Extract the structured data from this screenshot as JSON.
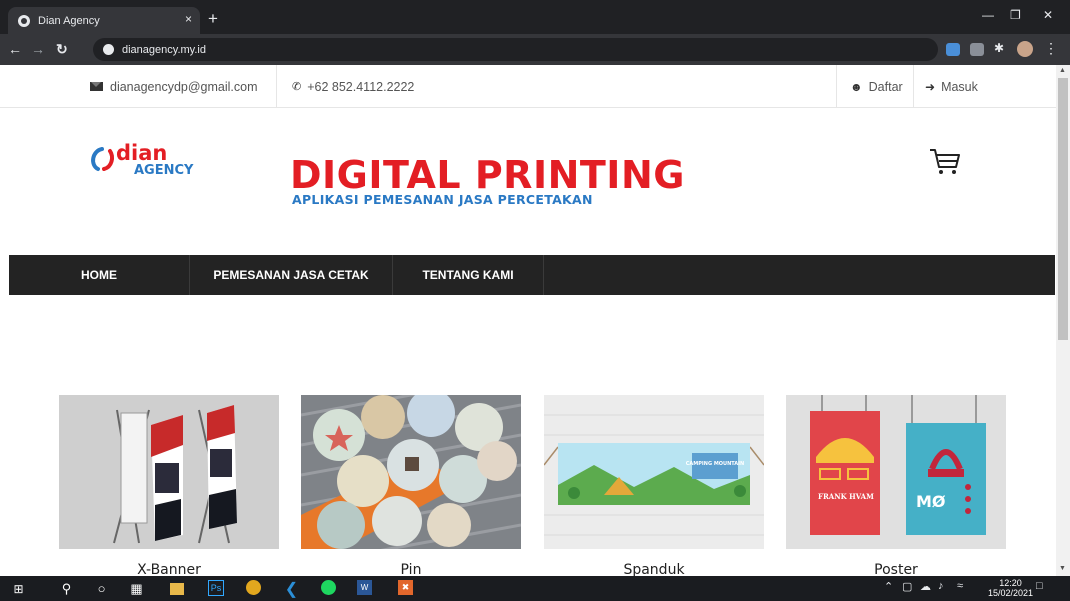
{
  "browser": {
    "tab_title": "Dian Agency",
    "tab_close": "×",
    "new_tab": "+",
    "url": "dianagency.my.id"
  },
  "topbar": {
    "email": "dianagencydp@gmail.com",
    "phone": "+62 852.4112.2222",
    "register": "Daftar",
    "login": "Masuk"
  },
  "header": {
    "logo_dian": "dian",
    "logo_agency": "AGENCY",
    "title": "DIGITAL PRINTING",
    "subtitle": "APLIKASI PEMESANAN JASA PERCETAKAN",
    "cart_icon": "shopping-cart-icon"
  },
  "nav": {
    "items": [
      {
        "label": "HOME"
      },
      {
        "label": "PEMESANAN JASA CETAK"
      },
      {
        "label": "TENTANG KAMI"
      }
    ]
  },
  "products": [
    {
      "name": "X-Banner"
    },
    {
      "name": "Pin"
    },
    {
      "name": "Spanduk"
    },
    {
      "name": "Poster"
    }
  ],
  "poster_art": {
    "left_text": "FRANK HVAM",
    "right_text": "MØ"
  },
  "banner_art": {
    "text": "CAMPING MOUNTAIN"
  },
  "taskbar": {
    "time": "12:20",
    "date": "15/02/2021"
  },
  "colors": {
    "brand_red": "#e31e24",
    "brand_blue": "#2a79c4",
    "nav_bg": "#232323"
  }
}
